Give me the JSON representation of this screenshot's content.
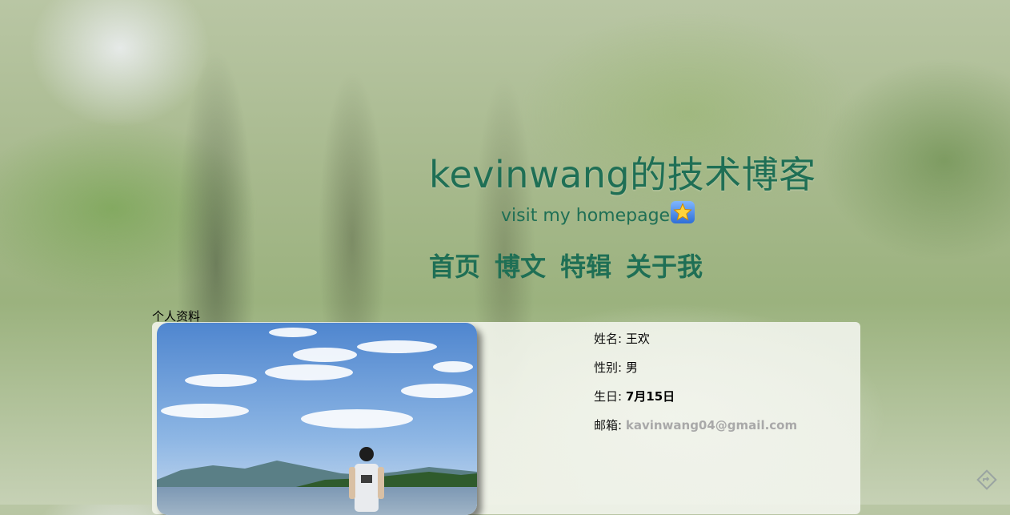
{
  "header": {
    "title": "kevinwang的技术博客",
    "subtitle": "visit my homepage"
  },
  "nav": [
    {
      "label": "首页"
    },
    {
      "label": "博文"
    },
    {
      "label": "特辑"
    },
    {
      "label": "关于我"
    }
  ],
  "profile": {
    "section_label": "个人资料",
    "fields": [
      {
        "key": "姓名:",
        "value": "王欢"
      },
      {
        "key": "性别:",
        "value": "男"
      },
      {
        "key": "生日:",
        "value": "7月15日"
      },
      {
        "key": "邮箱:",
        "value": "kavinwang04@gmail.com"
      }
    ]
  },
  "colors": {
    "accent": "#1f6f55",
    "email": "#a9a9a9"
  },
  "icons": {
    "star": "star-badge-icon",
    "corner": "share-arrow-icon"
  }
}
